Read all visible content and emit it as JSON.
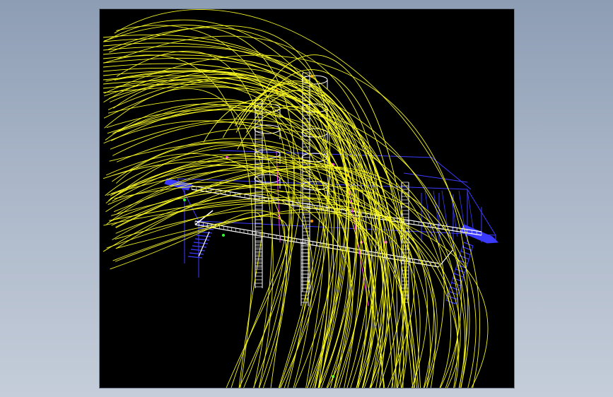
{
  "window": {
    "background_top": "#8d9db4",
    "background_bottom": "#c4cdd9"
  },
  "viewport": {
    "background": "#000000"
  },
  "colors": {
    "curves": "#ffff22",
    "structure": "#ffffff",
    "frame": "#3b3bff",
    "accent_magenta": "#ff33ff",
    "accent_green": "#33ff33",
    "accent_orange": "#ff9900"
  }
}
